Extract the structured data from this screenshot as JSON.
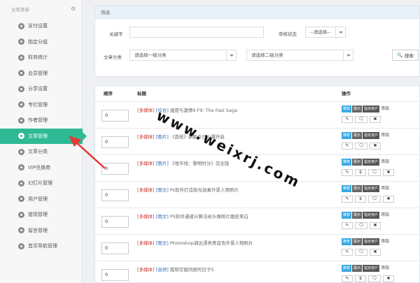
{
  "sidebar": {
    "header": "业务菜单",
    "items": [
      {
        "label": "支付设置",
        "active": false
      },
      {
        "label": "指定分组",
        "active": false
      },
      {
        "label": "财务统计",
        "active": false
      },
      {
        "label": "会员管理",
        "active": false
      },
      {
        "label": "分享设置",
        "active": false
      },
      {
        "label": "专栏管理",
        "active": false
      },
      {
        "label": "作者管理",
        "active": false
      },
      {
        "label": "文章管理",
        "active": true
      },
      {
        "label": "文章分类",
        "active": false
      },
      {
        "label": "VIP兑换券",
        "active": false
      },
      {
        "label": "幻灯片管理",
        "active": false
      },
      {
        "label": "用户管理",
        "active": false
      },
      {
        "label": "提现管理",
        "active": false
      },
      {
        "label": "留言管理",
        "active": false
      },
      {
        "label": "首页导航管理",
        "active": false
      }
    ]
  },
  "filter": {
    "title": "筛选",
    "keyword_label": "关键字",
    "keyword_value": "",
    "audit_label": "审核状态",
    "audit_value": "--请选择--",
    "category_label": "文章分类",
    "category1_value": "请选择一级分类",
    "category2_value": "请选择二级分类",
    "search_label": "搜索"
  },
  "table": {
    "headers": {
      "order": "顺序",
      "title": "标题",
      "ops": "操作"
    },
    "tags": {
      "recommend": "推荐",
      "show": "展示",
      "assign": "指定用户",
      "add": "添加"
    },
    "icons": {
      "edit": "✎",
      "dollar": "$",
      "comment": "🗨",
      "delete": "✖"
    },
    "rows": [
      {
        "order": "0",
        "type": "[多媒体]",
        "cat": "[综合]",
        "text": "速度与激情9 F9: The Fast Saga",
        "dollar": false
      },
      {
        "order": "0",
        "type": "[多媒体]",
        "cat": "[图片]",
        "text": "《荔枝》新服今日火爆开启",
        "dollar": false
      },
      {
        "order": "0",
        "type": "[多媒体]",
        "cat": "[图片]",
        "text": "《地平线：黎明时分》完全版",
        "dollar": true
      },
      {
        "order": "0",
        "type": "[多媒体]",
        "cat": "[图文]",
        "text": "Ps软件打造梨光效果外景人物照片",
        "dollar": true
      },
      {
        "order": "0",
        "type": "[多媒体]",
        "cat": "[图文]",
        "text": "PS软件通道计算法给头像照片磨皮美白",
        "dollar": false
      },
      {
        "order": "0",
        "type": "[多媒体]",
        "cat": "[图文]",
        "text": "Photoshop调出漂亮青蓝色外景人物照片",
        "dollar": false
      },
      {
        "order": "0",
        "type": "[多媒体]",
        "cat": "[音频]",
        "text": "我和空姐同居的日子5",
        "dollar": true
      }
    ]
  },
  "watermark": "www.weixrj.com",
  "colors": {
    "accent": "#2fb995",
    "tag_blue": "#3aa9e0",
    "tag_gray": "#666666",
    "red": "#c9302c",
    "arrow": "#e53935"
  }
}
